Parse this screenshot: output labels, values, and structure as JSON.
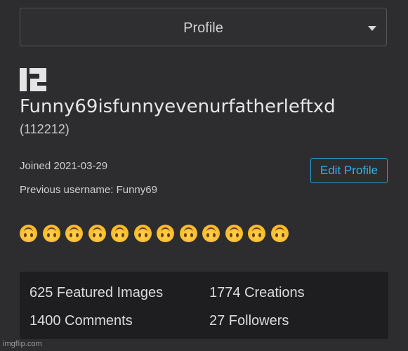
{
  "header": {
    "select_value": "Profile"
  },
  "profile": {
    "username": "Funny69isfunnyevenurfatherleftxd",
    "user_id": "(112212)",
    "joined": "Joined 2021-03-29",
    "previous_username": "Previous username: Funny69",
    "edit_button_label": "Edit Profile",
    "bio_emoji_count": 12,
    "bio_emoji_name": "upside-down-face"
  },
  "stats": {
    "featured": "625 Featured Images",
    "creations": "1774 Creations",
    "comments": "1400 Comments",
    "followers": "27 Followers"
  },
  "watermark": "imgflip.com",
  "colors": {
    "background": "#2d2d2f",
    "accent": "#36aee8",
    "stats_panel": "#1e1e20"
  }
}
